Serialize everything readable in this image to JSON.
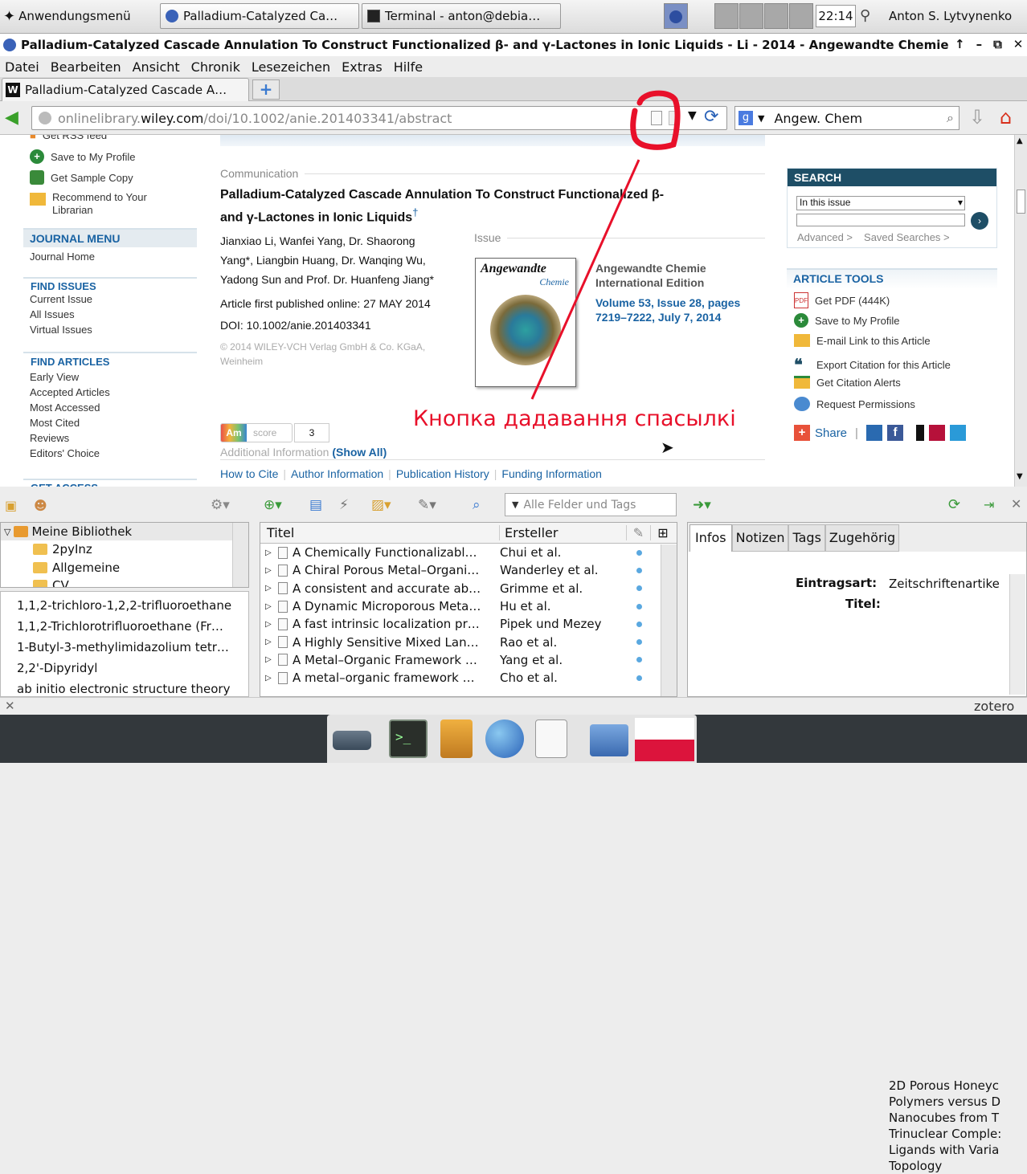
{
  "taskbar": {
    "app_menu": "Anwendungsmenü",
    "window1": "Palladium-Catalyzed Ca…",
    "window2": "Terminal - anton@debia…",
    "clock": "22:14",
    "user": "Anton S. Lytvynenko"
  },
  "window": {
    "title": "Palladium-Catalyzed Cascade Annulation To Construct Functionalized β- and γ-Lactones in Ionic Liquids - Li - 2014 - Angewandte Chemie",
    "controls": [
      "↑",
      "–",
      "⧉",
      "✕"
    ]
  },
  "menu": [
    "Datei",
    "Bearbeiten",
    "Ansicht",
    "Chronik",
    "Lesezeichen",
    "Extras",
    "Hilfe"
  ],
  "tab": {
    "label": "Palladium-Catalyzed Cascade A…",
    "new_tab": "+"
  },
  "nav": {
    "url_prefix": "onlinelibrary.",
    "url_domain": "wiley.com",
    "url_path": "/doi/10.1002/anie.201403341/abstract",
    "search_value": "Angew. Chem"
  },
  "left_sidebar": {
    "top_items": [
      "Get RSS feed",
      "Save to My Profile",
      "Get Sample Copy",
      "Recommend to Your",
      "Librarian"
    ],
    "journal_menu": {
      "heading": "JOURNAL MENU",
      "items": [
        "Journal Home"
      ]
    },
    "find_issues": {
      "heading": "FIND ISSUES",
      "items": [
        "Current Issue",
        "All Issues",
        "Virtual Issues"
      ]
    },
    "find_articles": {
      "heading": "FIND ARTICLES",
      "items": [
        "Early View",
        "Accepted Articles",
        "Most Accessed",
        "Most Cited",
        "Reviews",
        "Editors' Choice"
      ]
    },
    "get_access": "GET ACCESS"
  },
  "article": {
    "type": "Communication",
    "title_line1": "Palladium-Catalyzed Cascade Annulation To Construct Functionalized β-",
    "title_line2": "and γ-Lactones in Ionic Liquids",
    "title_dagger": "†",
    "authors_line1": "Jianxiao Li,   Wanfei Yang,   Dr. Shaorong",
    "authors_line2": "Yang*,   Liangbin Huang,   Dr. Wanqing Wu,",
    "authors_line3": "Yadong Sun and  Prof. Dr. Huanfeng Jiang*",
    "published": "Article first published online: 27 MAY 2014",
    "doi": "DOI: 10.1002/anie.201403341",
    "copyright_line1": "© 2014 WILEY-VCH Verlag GmbH & Co. KGaA,",
    "copyright_line2": "Weinheim",
    "issue_label": "Issue",
    "cover_title": "Angewandte",
    "cover_sub": "Chemie",
    "journal_line1": "Angewandte Chemie",
    "journal_line2": "International Edition",
    "volume_line1": "Volume 53, Issue 28, pages",
    "volume_line2": "7219–7222, July 7, 2014",
    "altmetric_am": "Am",
    "altmetric_score_label": "score",
    "altmetric_score": "3",
    "additional_info": "Additional Information",
    "show_all": "(Show All)",
    "bottom_links": [
      "How to Cite",
      "Author Information",
      "Publication History",
      "Funding Information"
    ]
  },
  "search_box": {
    "heading": "SEARCH",
    "scope": "In this issue",
    "advanced": "Advanced >",
    "saved": "Saved Searches >"
  },
  "article_tools": {
    "heading": "ARTICLE TOOLS",
    "items": [
      "Get PDF (444K)",
      "Save to My Profile",
      "E-mail Link to this Article",
      "Export Citation for this Article",
      "Get Citation Alerts",
      "Request Permissions"
    ],
    "share": "Share"
  },
  "annotation": {
    "text": "Кнопка дадавання спасылкі",
    "color": "#e8102a"
  },
  "zotero": {
    "search_placeholder": "Alle Felder und Tags",
    "library": "Meine Bibliothek",
    "collections": [
      "2pyInz",
      "Allgemeine",
      "CV"
    ],
    "tags": [
      "1,1,2-trichloro-1,2,2-trifluoroethane",
      "1,1,2-Trichlorotrifluoroethane (Fr…",
      "1-Butyl-3-methylimidazolium tetr…",
      "2,2'-Dipyridyl",
      "ab initio electronic structure theory"
    ],
    "col_title": "Titel",
    "col_creator": "Ersteller",
    "items": [
      {
        "title": "A Chemically Functionalizabl…",
        "creator": "Chui et al."
      },
      {
        "title": "A Chiral Porous Metal–Organi…",
        "creator": "Wanderley et al."
      },
      {
        "title": "A consistent and accurate ab…",
        "creator": "Grimme et al."
      },
      {
        "title": "A Dynamic Microporous Meta…",
        "creator": "Hu et al."
      },
      {
        "title": "A fast intrinsic localization pr…",
        "creator": "Pipek und Mezey"
      },
      {
        "title": "A Highly Sensitive Mixed Lan…",
        "creator": "Rao et al."
      },
      {
        "title": "A Metal–Organic Framework …",
        "creator": "Yang et al."
      },
      {
        "title": "A metal–organic framework …",
        "creator": "Cho et al."
      }
    ],
    "tabs": [
      "Infos",
      "Notizen",
      "Tags",
      "Zugehörig"
    ],
    "info_type_label": "Eintragsart:",
    "info_type_value": "Zeitschriftenartike",
    "info_title_label": "Titel:",
    "info_title_lines": [
      "2D Porous Honeyc",
      "Polymers versus D",
      "Nanocubes from T",
      "Trinuclear Comple:",
      "Ligands with Varia",
      "Topology"
    ],
    "brand": "zotero",
    "close": "✕"
  }
}
